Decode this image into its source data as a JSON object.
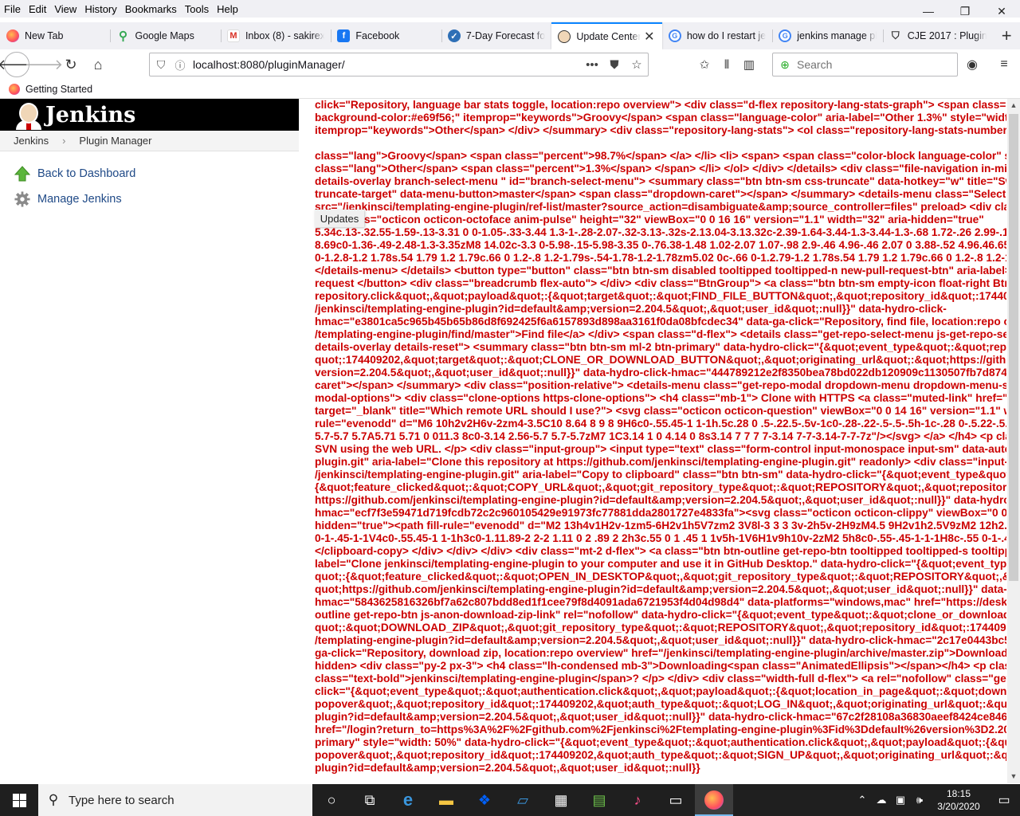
{
  "menubar": {
    "items": [
      "File",
      "Edit",
      "View",
      "History",
      "Bookmarks",
      "Tools",
      "Help"
    ],
    "accel": [
      "F",
      "E",
      "V",
      "s",
      "B",
      "T",
      "H"
    ]
  },
  "window_controls": {
    "minimize": "—",
    "restore": "❐",
    "close": "✕"
  },
  "tabs": [
    {
      "label": "New Tab",
      "icon": "firefox-icon"
    },
    {
      "label": "Google Maps",
      "icon": "google-maps-icon"
    },
    {
      "label": "Inbox (8) - sakirex",
      "icon": "gmail-icon"
    },
    {
      "label": "Facebook",
      "icon": "facebook-icon"
    },
    {
      "label": "7-Day Forecast for",
      "icon": "weather-icon"
    },
    {
      "label": "Update Center",
      "icon": "jenkins-icon",
      "active": true
    },
    {
      "label": "how do I restart je",
      "icon": "google-icon"
    },
    {
      "label": "jenkins manage pl",
      "icon": "google-icon"
    },
    {
      "label": "CJE 2017 : Plugins",
      "icon": "cloudbees-icon"
    }
  ],
  "navbar": {
    "url": "localhost:8080/pluginManager/",
    "search_placeholder": "Search"
  },
  "bookmarks": {
    "getting_started": "Getting Started"
  },
  "jenkins": {
    "title": "Jenkins",
    "breadcrumbs": [
      "Jenkins",
      "Plugin Manager"
    ],
    "tasks": [
      "Back to Dashboard",
      "Manage Jenkins"
    ],
    "updates_tooltip": "Updates"
  },
  "code_lines": [
    "click=\"Repository, language bar stats toggle, location:repo overview\"> <div class=\"d-flex repository-lang-stats-graph\"> <span class=\"lang",
    "background-color:#e69f56;\" itemprop=\"keywords\">Groovy</span> <span class=\"language-color\" aria-label=\"Other 1.3%\" style=\"width:1.3",
    "itemprop=\"keywords\">Other</span> </div> </summary> <div class=\"repository-lang-stats\"> <ol class=\"repository-lang-stats-numbers\"> <li",
    "",
    "class=\"lang\">Groovy</span> <span class=\"percent\">98.7%</span> </a> </li> <li> <span> <span class=\"color-block language-color\" style=",
    "class=\"lang\">Other</span> <span class=\"percent\">1.3%</span> </span> </li> </ol> </div> </details> <div class=\"file-navigation in-mid-pa",
    "details-overlay branch-select-menu \" id=\"branch-select-menu\"> <summary class=\"btn btn-sm css-truncate\" data-hotkey=\"w\" title=\"Switch",
    "truncate-target\" data-menu-button>master</span> <span class=\"dropdown-caret\"></span> </summary> <details-menu class=\"SelectMenu",
    "src=\"/jenkinsci/templating-engine-plugin/ref-list/master?source_action=disambiguate&amp;source_controller=files\" preload> <div class=\"SelectMenu-modal\"> <include-fragm",
    "       <svg class=\"octicon octicon-octoface anim-pulse\" height=\"32\" viewBox=\"0 0 16 16\" version=\"1.1\" width=\"32\" aria-hidden=\"true\"",
    "5.34c.13-.32.55-1.59-.13-3.31 0 0-1.05-.33-3.44 1.3-1-.28-2.07-.32-3.13-.32s-2.13.04-3.13.32c-2.39-1.64-3.44-1.3-3.44-1.3-.68 1.72-.26 2.99-.13 3.31C4.",
    "8.69c0-1.36-.49-2.48-1.3-3.35zM8 14.02c-3.3 0-5.98-.15-5.98-3.35 0-.76.38-1.48 1.02-2.07 1.07-.98 2.9-.46 4.96-.46 2.07 0 3.88-.52 4.96.46.65.59 1.02",
    "0-1.2.8-1.2 1.78s.54 1.79 1.2 1.79c.66 0 1.2-.8 1.2-1.79s-.54-1.78-1.2-1.78zm5.02 0c-.66 0-1.2.79-1.2 1.78s.54 1.79 1.2 1.79c.66 0 1.2-.8 1.2-1.79s-.53",
    "</details-menu> </details> <button type=\"button\" class=\"btn btn-sm disabled tooltipped tooltipped-n new-pull-request-btn\" aria-label=\"You",
    "request </button> <div class=\"breadcrumb flex-auto\"> </div> <div class=\"BtnGroup\"> <a class=\"btn btn-sm empty-icon float-right BtnGrou",
    "repository.click&quot;,&quot;payload&quot;:{&quot;target&quot;:&quot;FIND_FILE_BUTTON&quot;,&quot;repository_id&quot;:174409202,&q",
    "/jenkinsci/templating-engine-plugin?id=default&amp;version=2.204.5&quot;,&quot;user_id&quot;:null}}\" data-hydro-click-",
    "hmac=\"e3801ca5c965b45b65b86d8f692425f6a6157893d898aa3161f0da08bfcdec34\" data-ga-click=\"Repository, find file, location:repo overvie",
    "/templating-engine-plugin/find/master\">Find file</a> </div> <span class=\"d-flex\"> <details class=\"get-repo-select-menu js-get-repo-select-",
    "details-overlay details-reset\"> <summary class=\"btn btn-sm ml-2 btn-primary\" data-hydro-click=\"{&quot;event_type&quot;:&quot;repository",
    "quot;:174409202,&quot;target&quot;:&quot;CLONE_OR_DOWNLOAD_BUTTON&quot;,&quot;originating_url&quot;:&quot;https://github.com/j",
    "version=2.204.5&quot;,&quot;user_id&quot;:null}}\" data-hydro-click-hmac=\"444789212e2f8350bea78bd022db120909c1130507fb7d874e86d4bc",
    "caret\"></span> </summary> <div class=\"position-relative\"> <details-menu class=\"get-repo-modal dropdown-menu dropdown-menu-sw pb-0 js-toggl",
    "modal-options\"> <div class=\"clone-options https-clone-options\"> <h4 class=\"mb-1\"> Clone with HTTPS <a class=\"muted-link\" href=\"https:/",
    "target=\"_blank\" title=\"Which remote URL should I use?\"> <svg class=\"octicon octicon-question\" viewBox=\"0 0 14 16\" version=\"1.1\" width=",
    "rule=\"evenodd\" d=\"M6 10h2v2H6v-2zm4-3.5C10 8.64 8 9 8 9H6c0-.55.45-1 1-1h.5c.28 0 .5-.22.5-.5v-1c0-.28-.22-.5-.5-.5h-1c-.28 0-.5.22-.5.5V7H4c",
    "5.7-5.7 5.7A5.71 5.71 0 011.3 8c0-3.14 2.56-5.7 5.7-5.7zM7 1C3.14 1 0 4.14 0 8s3.14 7 7 7 7-3.14 7-7-3.14-7-7-7z\"/></svg> </a> </h4> <p class=\"m",
    "SVN using the web URL. </p> <div class=\"input-group\"> <input type=\"text\" class=\"form-control input-monospace input-sm\" data-autoselec",
    "plugin.git\" aria-label=\"Clone this repository at https://github.com/jenkinsci/templating-engine-plugin.git\" readonly> <div class=\"input-grou",
    "/jenkinsci/templating-engine-plugin.git\" aria-label=\"Copy to clipboard\" class=\"btn btn-sm\" data-hydro-click=\"{&quot;event_type&quot;:&qu",
    "{&quot;feature_clicked&quot;:&quot;COPY_URL&quot;,&quot;git_repository_type&quot;:&quot;REPOSITORY&quot;,&quot;repository_id&qu",
    "https://github.com/jenkinsci/templating-engine-plugin?id=default&amp;version=2.204.5&quot;,&quot;user_id&quot;:null}}\" data-hydro-click",
    "hmac=\"ecf7f3e59471d719fcdb72c2c960105429e91973fc77881dda2801727e4833fa\"><svg class=\"octicon octicon-clippy\" viewBox=\"0 0 14 16\" w",
    "hidden=\"true\"><path fill-rule=\"evenodd\" d=\"M2 13h4v1H2v-1zm5-6H2v1h5V7zm2 3V8l-3 3 3 3v-2h5v-2H9zM4.5 9H2v1h2.5V9zM2 12h2.5v-1H2",
    "0-1-.45-1-1V4c0-.55.45-1 1-1h3c0-1.11.89-2 2-2 1.11 0 2 .89 2 2h3c.55 0 1 .45 1 1v5h-1V6H1v9h10v-2zM2 5h8c0-.55-.45-1-1-1H8c-.55 0-1-.45-1-1s-.4",
    "</clipboard-copy> </div> </div> </div> <div class=\"mt-2 d-flex\"> <a class=\"btn btn-outline get-repo-btn tooltipped tooltipped-s tooltipped-n",
    "label=\"Clone jenkinsci/templating-engine-plugin to your computer and use it in GitHub Desktop.\" data-hydro-click=\"{&quot;event_type&qu",
    "quot;:{&quot;feature_clicked&quot;:&quot;OPEN_IN_DESKTOP&quot;,&quot;git_repository_type&quot;:&quot;REPOSITORY&quot;,&quot;rep",
    "quot;https://github.com/jenkinsci/templating-engine-plugin?id=default&amp;version=2.204.5&quot;,&quot;user_id&quot;:null}}\" data-hydro",
    "hmac=\"5843625816326bf7a62c807bdd8ed1f1cee79f8d4091ada6721953f4d04d98d4\" data-platforms=\"windows,mac\" href=\"https://desktop.gith",
    "outline get-repo-btn js-anon-download-zip-link\" rel=\"nofollow\" data-hydro-click=\"{&quot;event_type&quot;:&quot;clone_or_download.click",
    "quot;:&quot;DOWNLOAD_ZIP&quot;,&quot;git_repository_type&quot;:&quot;REPOSITORY&quot;,&quot;repository_id&quot;:174409202,&quo",
    "/templating-engine-plugin?id=default&amp;version=2.204.5&quot;,&quot;user_id&quot;:null}}\" data-hydro-click-hmac=\"2c17e0443bc53ea7f",
    "ga-click=\"Repository, download zip, location:repo overview\" href=\"/jenkinsci/templating-engine-plugin/archive/master.zip\">Download ZIP",
    "hidden> <div class=\"py-2 px-3\"> <h4 class=\"lh-condensed mb-3\">Downloading<span class=\"AnimatedEllipsis\"></span></h4> <p class=\"te",
    "class=\"text-bold\">jenkinsci/templating-engine-plugin</span>? </p> </div> <div class=\"width-full d-flex\"> <a rel=\"nofollow\" class=\"get-rep",
    "click=\"{&quot;event_type&quot;:&quot;authentication.click&quot;,&quot;payload&quot;:{&quot;location_in_page&quot;:&quot;download",
    "popover&quot;,&quot;repository_id&quot;:174409202,&quot;auth_type&quot;:&quot;LOG_IN&quot;,&quot;originating_url&quot;:&quot;https:",
    "plugin?id=default&amp;version=2.204.5&quot;,&quot;user_id&quot;:null}}\" data-hydro-click-hmac=\"67c2f28108a36830aeef8424ce84691e4ca",
    "href=\"/login?return_to=https%3A%2F%2Fgithub.com%2Fjenkinsci%2Ftemplating-engine-plugin%3Fid%3Ddefault%26version%3D2.204.5\">Sig",
    "primary\" style=\"width: 50%\" data-hydro-click=\"{&quot;event_type&quot;:&quot;authentication.click&quot;,&quot;payload&quot;:{&quot;loca",
    "popover&quot;,&quot;repository_id&quot;:174409202,&quot;auth_type&quot;:&quot;SIGN_UP&quot;,&quot;originating_url&quot;:&quot;http",
    "plugin?id=default&amp;version=2.204.5&quot;,&quot;user_id&quot;:null}}"
  ],
  "taskbar": {
    "search_placeholder": "Type here to search",
    "time": "18:15",
    "date": "3/20/2020"
  }
}
